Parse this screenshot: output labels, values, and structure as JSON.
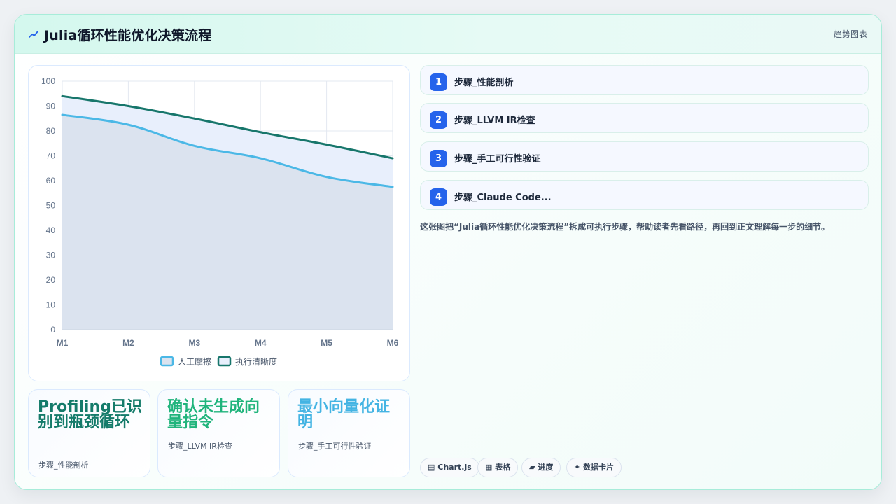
{
  "header": {
    "title": "Julia循环性能优化决策流程",
    "badge": "趋势图表"
  },
  "chart_data": {
    "type": "area",
    "categories": [
      "M1",
      "M2",
      "M3",
      "M4",
      "M5",
      "M6"
    ],
    "series": [
      {
        "name": "人工摩擦",
        "values": [
          86.5,
          82.5,
          74,
          69,
          61.5,
          57.5
        ],
        "color": "#4bb8e6",
        "fill": "#dbe3ef"
      },
      {
        "name": "执行清晰度",
        "values": [
          94,
          90,
          85,
          79.5,
          74.5,
          69
        ],
        "color": "#17766b",
        "fill": "#e8effc"
      }
    ],
    "yticks": [
      0,
      10,
      20,
      30,
      40,
      50,
      60,
      70,
      80,
      90,
      100
    ],
    "ylim": [
      0,
      100
    ],
    "grid": true,
    "legend": "bottom",
    "title": "",
    "xlabel": "",
    "ylabel": ""
  },
  "kpis": [
    {
      "value": "Profiling已识别到瓶颈循环",
      "label": "步骤_性能剖析",
      "color": "#147b6a"
    },
    {
      "value": "确认未生成向量指令",
      "label": "步骤_LLVM IR检查",
      "color": "#20b47c"
    },
    {
      "value": "最小向量化证明",
      "label": "步骤_手工可行性验证",
      "color": "#44b4e3"
    }
  ],
  "steps": [
    {
      "num": "1",
      "label": "步骤_性能剖析"
    },
    {
      "num": "2",
      "label": "步骤_LLVM IR检查"
    },
    {
      "num": "3",
      "label": "步骤_手工可行性验证"
    },
    {
      "num": "4",
      "label": "步骤_Claude Code..."
    }
  ],
  "description": "这张图把“Julia循环性能优化决策流程”拆成可执行步骤，帮助读者先看路径，再回到正文理解每一步的细节。",
  "tags": [
    {
      "icon": "▤",
      "label": "Chart.js"
    },
    {
      "icon": "▦",
      "label": "表格"
    },
    {
      "icon": "▰",
      "label": "进度"
    },
    {
      "icon": "✦",
      "label": "数据卡片"
    }
  ],
  "colors": {
    "accent": "#2563eb",
    "border": "#a7ecd9"
  }
}
